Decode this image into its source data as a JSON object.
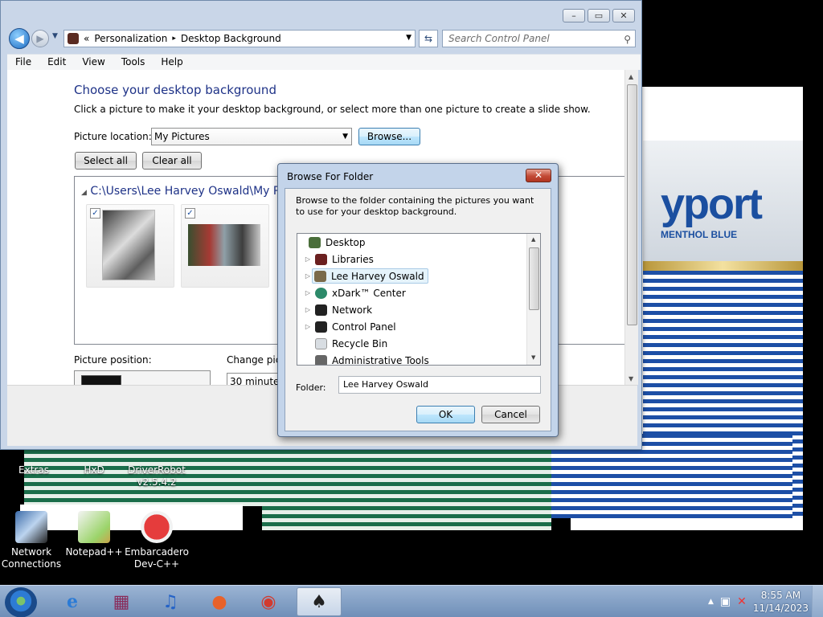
{
  "window": {
    "minimize_label": "▭",
    "maximize_label": "▢",
    "close_label": "✕"
  },
  "address": {
    "breadcrumb_prefix": "«",
    "crumb1": "Personalization",
    "sep": "▸",
    "crumb2": "Desktop Background",
    "search_placeholder": "Search Control Panel"
  },
  "menu": [
    "File",
    "Edit",
    "View",
    "Tools",
    "Help"
  ],
  "page": {
    "title": "Choose your desktop background",
    "subtitle": "Click a picture to make it your desktop background, or select more than one picture to create a slide show.",
    "location_label": "Picture location:",
    "location_value": "My Pictures",
    "browse_label": "Browse...",
    "select_all_label": "Select all",
    "clear_all_label": "Clear all",
    "gallery_path": "C:\\Users\\Lee Harvey Oswald\\My Pic",
    "position_label": "Picture position:",
    "change_label": "Change pict",
    "interval_value": "30 minutes"
  },
  "dialog": {
    "title": "Browse For Folder",
    "close_label": "✕",
    "description": "Browse to the folder containing the pictures you want to use for your desktop background.",
    "tree": [
      {
        "label": "Desktop",
        "icon": "desktop-icon",
        "color": "#4a6e3a"
      },
      {
        "label": "Libraries",
        "icon": "libraries-icon",
        "color": "#6b2020"
      },
      {
        "label": "Lee Harvey Oswald",
        "icon": "user-folder-icon",
        "color": "#7a6a4a"
      },
      {
        "label": "xDark™ Center",
        "icon": "xdark-center-icon",
        "color": "#2d8a6a"
      },
      {
        "label": "Network",
        "icon": "network-icon",
        "color": "#222222"
      },
      {
        "label": "Control Panel",
        "icon": "control-panel-icon",
        "color": "#222222"
      },
      {
        "label": "Recycle Bin",
        "icon": "recycle-bin-icon",
        "color": "#e0e0e0"
      },
      {
        "label": "Administrative Tools",
        "icon": "admin-tools-icon",
        "color": "#666666"
      }
    ],
    "folder_label": "Folder:",
    "folder_value": "Lee Harvey Oswald",
    "ok_label": "OK",
    "cancel_label": "Cancel"
  },
  "desktop": {
    "icons": [
      {
        "label": "Extras",
        "icon": "extras-icon"
      },
      {
        "label": "HxD",
        "icon": "hxd-icon"
      },
      {
        "label": "DriverRobot v2.5.4.2",
        "icon": "driverrobot-icon"
      },
      {
        "label": "Network Connections",
        "icon": "network-connections-icon"
      },
      {
        "label": "Notepad++",
        "icon": "notepadpp-icon"
      },
      {
        "label": "Embarcadero Dev-C++",
        "icon": "devcpp-icon"
      }
    ],
    "wallpaper_brand": "yport",
    "wallpaper_sub": "MENTHOL BLUE"
  },
  "taskbar": {
    "apps": [
      {
        "name": "internet-explorer-icon",
        "glyph": "e"
      },
      {
        "name": "winrar-icon",
        "glyph": "▦"
      },
      {
        "name": "itunes-icon",
        "glyph": "♫"
      },
      {
        "name": "firefox-icon",
        "glyph": "●"
      },
      {
        "name": "chrome-icon",
        "glyph": "◉"
      },
      {
        "name": "personalization-icon",
        "glyph": "♠"
      }
    ],
    "time": "8:55 AM",
    "date": "11/14/2023",
    "tray_arrow": "▲"
  },
  "colors": {
    "accent_title": "#1e3287",
    "selection": "#e5f3fb",
    "close_red": "#c24a36"
  }
}
